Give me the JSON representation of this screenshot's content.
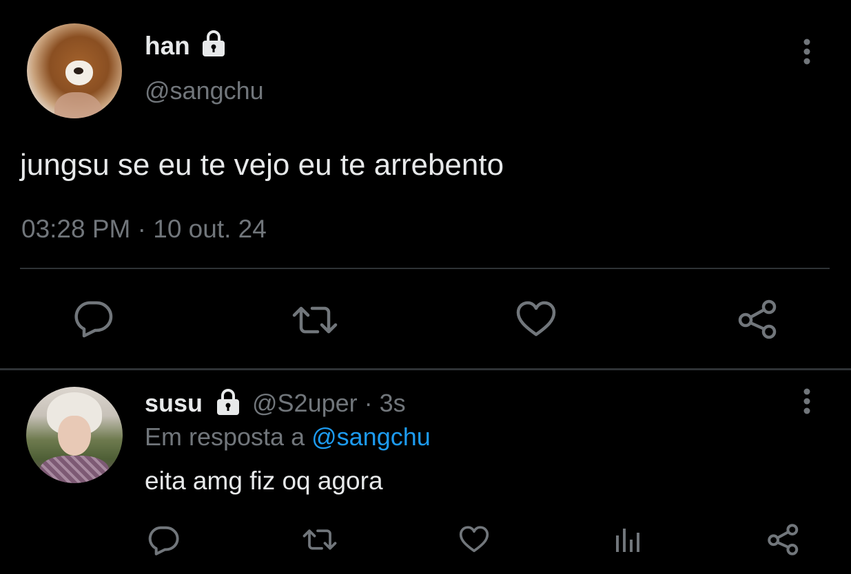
{
  "main_tweet": {
    "display_name": "han",
    "handle": "@sangchu",
    "text": "jungsu se eu te vejo eu te arrebento",
    "timestamp": "03:28 PM · 10 out. 24",
    "actions": [
      "reply-icon",
      "retweet-icon",
      "like-icon",
      "share-icon"
    ]
  },
  "reply_tweet": {
    "display_name": "susu",
    "handle_time": "@S2uper · 3s",
    "in_reply_prefix": "Em resposta a ",
    "in_reply_mention": "@sangchu",
    "text": "eita amg fiz oq agora",
    "actions": [
      "reply-icon",
      "retweet-icon",
      "like-icon",
      "analytics-icon",
      "share-icon"
    ]
  },
  "colors": {
    "background": "#000000",
    "primary_text": "#e7e9ea",
    "secondary_text": "#71767b",
    "mention": "#1d9bf0",
    "divider": "#2f3336"
  }
}
